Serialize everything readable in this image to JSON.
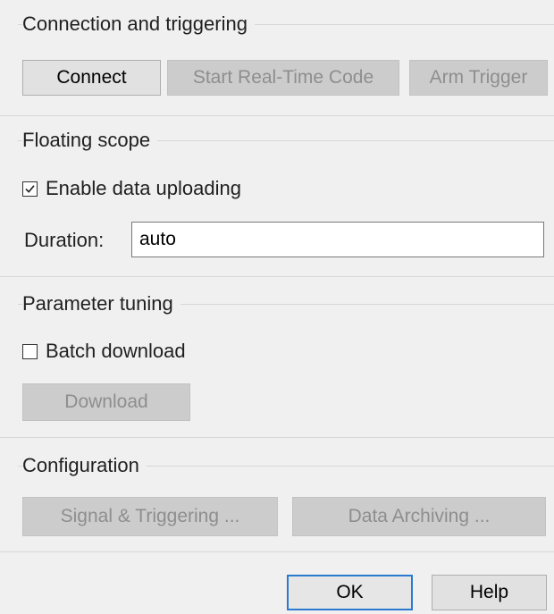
{
  "connection": {
    "title": "Connection and triggering",
    "connect_label": "Connect",
    "start_label": "Start Real-Time Code",
    "arm_label": "Arm Trigger"
  },
  "floating_scope": {
    "title": "Floating scope",
    "enable_upload_label": "Enable data uploading",
    "enable_upload_checked": true,
    "duration_label": "Duration:",
    "duration_value": "auto"
  },
  "parameter_tuning": {
    "title": "Parameter tuning",
    "batch_label": "Batch download",
    "batch_checked": false,
    "download_label": "Download"
  },
  "configuration": {
    "title": "Configuration",
    "signal_label": "Signal & Triggering ...",
    "archiving_label": "Data Archiving ..."
  },
  "footer": {
    "ok_label": "OK",
    "help_label": "Help"
  },
  "colors": {
    "background": "#f0f0f0",
    "disabled_button": "#cccccc",
    "default_button_border": "#2a7bd0"
  }
}
